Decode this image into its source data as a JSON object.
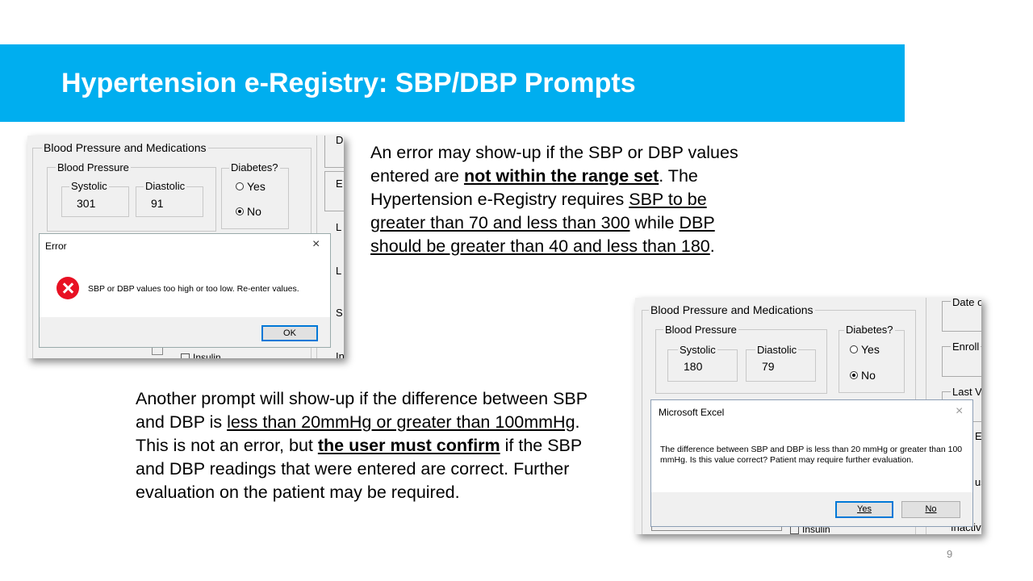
{
  "slide": {
    "title": "Hypertension e-Registry: SBP/DBP Prompts",
    "page_number": "9",
    "accent_color": "#00aeef"
  },
  "para1": {
    "t1": "An error may show-up if the SBP or DBP values entered are ",
    "b1": "not within the range set",
    "t2": ". The Hypertension e-Registry requires ",
    "u1": "SBP to be greater than 70 and less than 300",
    "t3": " while ",
    "u2": "DBP should be greater than 40 and less than 180",
    "t4": "."
  },
  "para2": {
    "t1": "Another prompt will show-up if the difference between SBP and DBP is ",
    "u1": "less than 20mmHg or greater than 100mmHg",
    "t2": ". This is not an error, but ",
    "b1": "the user must confirm",
    "t3": " if the SBP and DBP readings that were entered are correct. Further evaluation on the patient may be required."
  },
  "shot1": {
    "group_label": "Blood Pressure and Medications",
    "bp_label": "Blood Pressure",
    "systolic_label": "Systolic",
    "systolic_value": "301",
    "diastolic_label": "Diastolic",
    "diastolic_value": "91",
    "diabetes_label": "Diabetes?",
    "yes_label": "Yes",
    "no_label": "No",
    "insulin_label": "Insulin",
    "side_letters": [
      "D",
      "E",
      "L",
      "L",
      "S",
      "In"
    ],
    "dialog": {
      "title": "Error",
      "message": "SBP or DBP values too high or too low. Re-enter values.",
      "ok_label": "OK",
      "close_icon": "×"
    }
  },
  "shot2": {
    "group_label": "Blood Pressure and Medications",
    "bp_label": "Blood Pressure",
    "systolic_label": "Systolic",
    "systolic_value": "180",
    "diastolic_label": "Diastolic",
    "diastolic_value": "79",
    "diabetes_label": "Diabetes?",
    "yes_label": "Yes",
    "no_label": "No",
    "insulin_label": "Insulin",
    "side_labels": [
      "Date o",
      "Enroll",
      "Last V",
      "E",
      "us",
      "Inactiv"
    ],
    "dialog": {
      "title": "Microsoft Excel",
      "message": "The difference between SBP and DBP is less than 20 mmHg or greater than 100 mmHg. Is this value correct? Patient may require further evaluation.",
      "yes_label": "Yes",
      "no_label": "No",
      "close_icon": "×"
    }
  }
}
